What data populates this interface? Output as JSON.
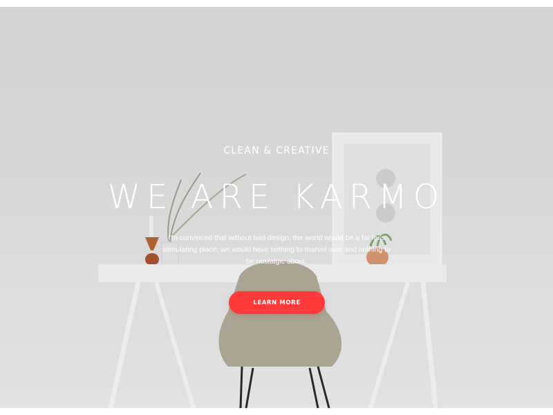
{
  "hero": {
    "eyebrow": "CLEAN & CREATIVE",
    "headline": "WE ARE KARMO",
    "tagline": "I'm convinced that without bad design, the world would be a far less stimulating place; we would have nothing to marvel over and nothing to be nostalgic about.",
    "cta_label": "LEARN MORE"
  },
  "colors": {
    "accent": "#ff3a3a",
    "background": "#dedede",
    "text": "#ffffff"
  }
}
